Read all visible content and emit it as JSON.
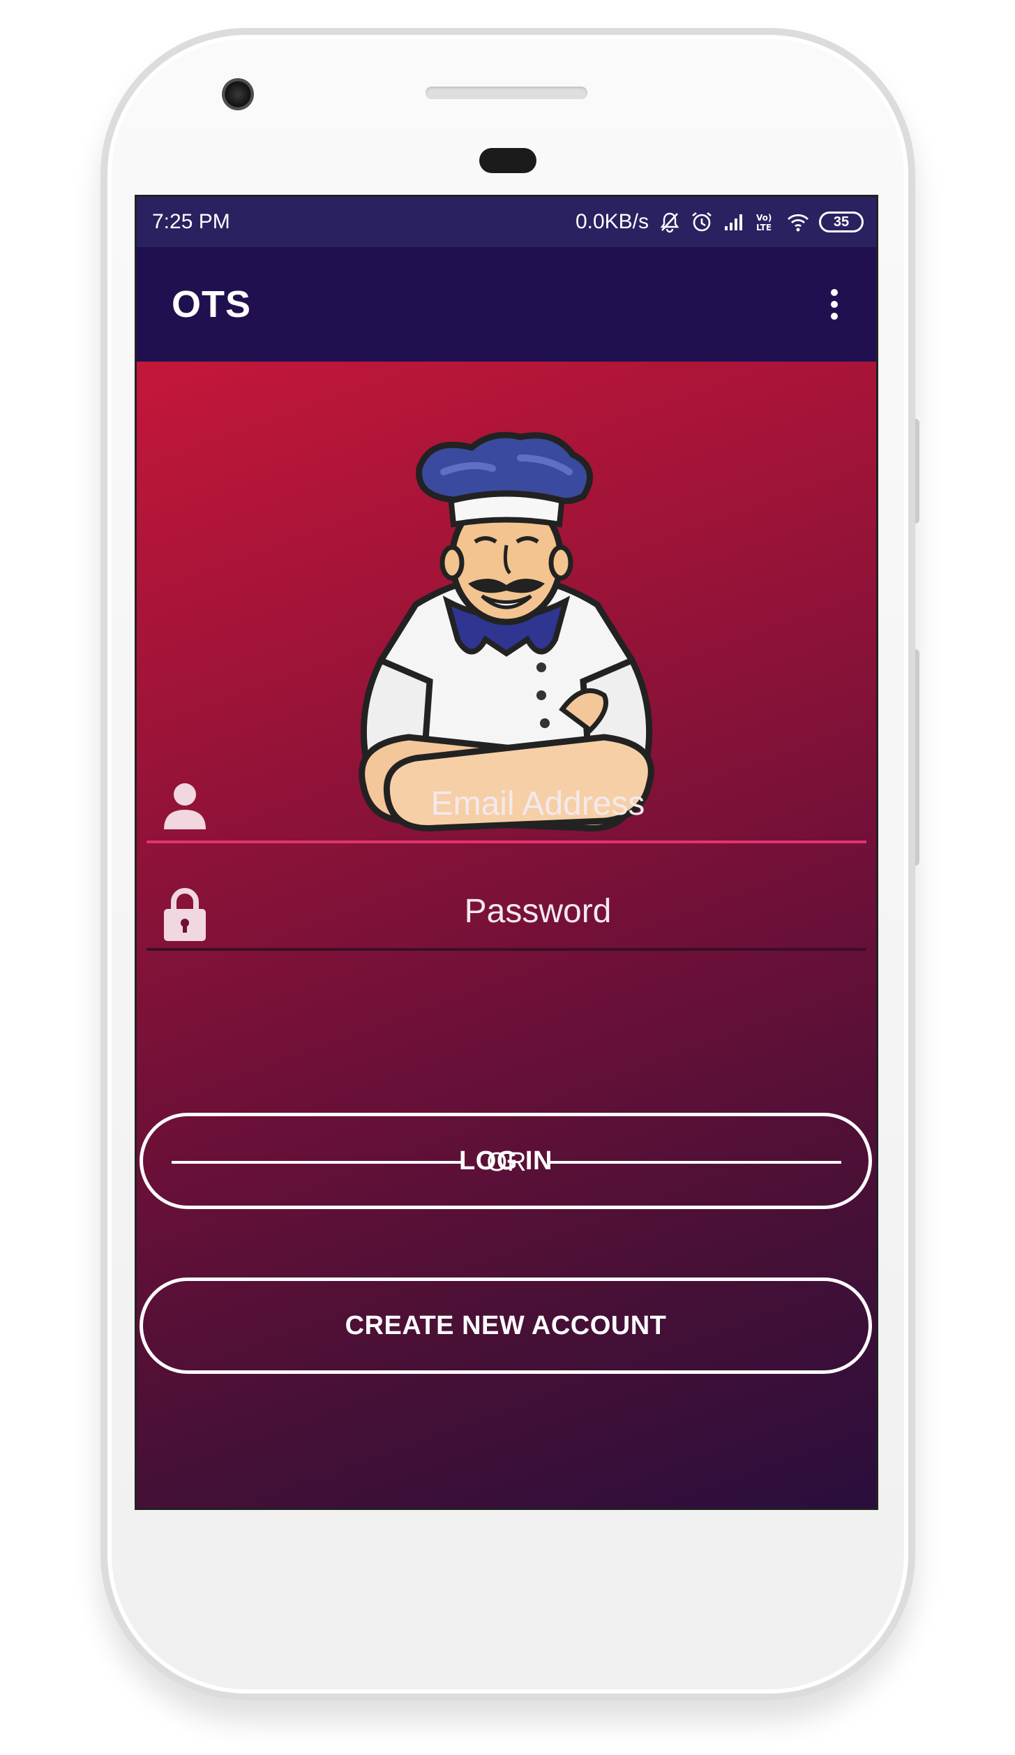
{
  "status_bar": {
    "time": "7:25 PM",
    "net_speed": "0.0KB/s",
    "battery_level": "35",
    "icons": [
      "mute-notifications-icon",
      "alarm-icon",
      "signal-icon",
      "volte-icon",
      "wifi-icon",
      "battery-icon"
    ],
    "volte_label": "Vo)) LTE"
  },
  "app_bar": {
    "title": "OTS",
    "overflow_icon": "more-vert-icon",
    "background": "#211050"
  },
  "hero": {
    "image": "chef-mascot-illustration"
  },
  "form": {
    "email": {
      "placeholder": "Email Address",
      "value": "",
      "icon": "person-icon",
      "underline_color": "#e2336f"
    },
    "password": {
      "placeholder": "Password",
      "value": "",
      "icon": "lock-icon",
      "underline_color": "#3a0f28"
    },
    "login_label": "LOG IN",
    "or_label": "OR",
    "create_account_label": "CREATE NEW ACCOUNT"
  },
  "colors": {
    "gradient_start": "#c4173a",
    "gradient_end": "#2a0e3c",
    "status_bar": "#2a2160",
    "accent": "#e2336f"
  }
}
